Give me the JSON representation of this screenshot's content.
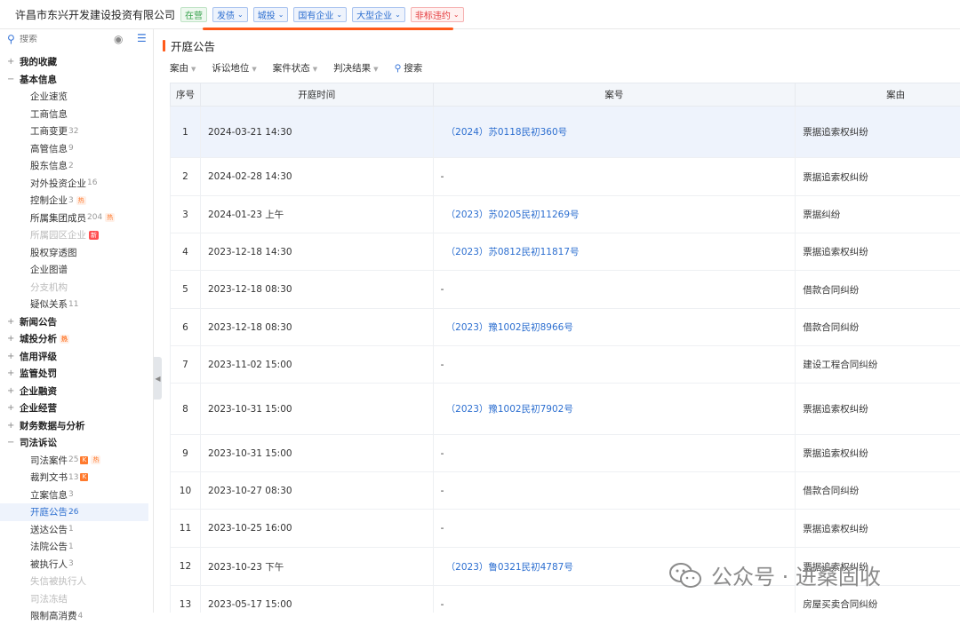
{
  "header": {
    "company": "许昌市东兴开发建设投资有限公司",
    "status_tag": "在营",
    "tags": [
      {
        "label": "发债",
        "color": "blue"
      },
      {
        "label": "城投",
        "color": "blue"
      },
      {
        "label": "国有企业",
        "color": "blue"
      },
      {
        "label": "大型企业",
        "color": "blue"
      },
      {
        "label": "非标违约",
        "color": "red"
      }
    ]
  },
  "sidebar": {
    "search_placeholder": "搜索",
    "tree": [
      {
        "type": "group",
        "label": "我的收藏",
        "sign": "+"
      },
      {
        "type": "group",
        "label": "基本信息",
        "sign": "−"
      },
      {
        "type": "child",
        "label": "企业速览"
      },
      {
        "type": "child",
        "label": "工商信息"
      },
      {
        "type": "child",
        "label": "工商变更",
        "count": "32"
      },
      {
        "type": "child",
        "label": "高管信息",
        "count": "9"
      },
      {
        "type": "child",
        "label": "股东信息",
        "count": "2"
      },
      {
        "type": "child",
        "label": "对外投资企业",
        "count": "16"
      },
      {
        "type": "child",
        "label": "控制企业",
        "count": "3",
        "badge": "hot",
        "badge_text": "热"
      },
      {
        "type": "child",
        "label": "所属集团成员",
        "count": "204",
        "badge": "hot",
        "badge_text": "热"
      },
      {
        "type": "child",
        "label": "所属园区企业",
        "disabled": true,
        "badge": "new",
        "badge_text": "新"
      },
      {
        "type": "child",
        "label": "股权穿透图"
      },
      {
        "type": "child",
        "label": "企业图谱"
      },
      {
        "type": "child",
        "label": "分支机构",
        "disabled": true
      },
      {
        "type": "child",
        "label": "疑似关系",
        "count": "11"
      },
      {
        "type": "group",
        "label": "新闻公告",
        "sign": "+"
      },
      {
        "type": "group",
        "label": "城投分析",
        "sign": "+",
        "badge": "hot",
        "badge_text": "热"
      },
      {
        "type": "group",
        "label": "信用评级",
        "sign": "+"
      },
      {
        "type": "group",
        "label": "监管处罚",
        "sign": "+"
      },
      {
        "type": "group",
        "label": "企业融资",
        "sign": "+"
      },
      {
        "type": "group",
        "label": "企业经营",
        "sign": "+"
      },
      {
        "type": "group",
        "label": "财务数据与分析",
        "sign": "+"
      },
      {
        "type": "group",
        "label": "司法诉讼",
        "sign": "−"
      },
      {
        "type": "child",
        "label": "司法案件",
        "count": "25",
        "badge": "k",
        "badge2": "hot",
        "badge_text": "热"
      },
      {
        "type": "child",
        "label": "裁判文书",
        "count": "13",
        "badge": "k"
      },
      {
        "type": "child",
        "label": "立案信息",
        "count": "3"
      },
      {
        "type": "child",
        "label": "开庭公告",
        "count": "26",
        "active": true
      },
      {
        "type": "child",
        "label": "送达公告",
        "count": "1"
      },
      {
        "type": "child",
        "label": "法院公告",
        "count": "1"
      },
      {
        "type": "child",
        "label": "被执行人",
        "count": "3"
      },
      {
        "type": "child",
        "label": "失信被执行人",
        "disabled": true
      },
      {
        "type": "child",
        "label": "司法冻结",
        "disabled": true
      },
      {
        "type": "child",
        "label": "限制高消费",
        "count": "4"
      }
    ]
  },
  "main": {
    "title": "开庭公告",
    "filters": [
      "案由",
      "诉讼地位",
      "案件状态",
      "判决结果"
    ],
    "search_label": "搜索",
    "columns": [
      "序号",
      "开庭时间",
      "案号",
      "案由"
    ],
    "rows": [
      {
        "no": "1",
        "time": "2024-03-21 14:30",
        "case": "（2024）苏0118民初360号",
        "reason": "票据追索权纠纷"
      },
      {
        "no": "2",
        "time": "2024-02-28 14:30",
        "case": "-",
        "reason": "票据追索权纠纷"
      },
      {
        "no": "3",
        "time": "2024-01-23 上午",
        "case": "（2023）苏0205民初11269号",
        "reason": "票据纠纷"
      },
      {
        "no": "4",
        "time": "2023-12-18 14:30",
        "case": "（2023）苏0812民初11817号",
        "reason": "票据追索权纠纷"
      },
      {
        "no": "5",
        "time": "2023-12-18 08:30",
        "case": "-",
        "reason": "借款合同纠纷"
      },
      {
        "no": "6",
        "time": "2023-12-18 08:30",
        "case": "（2023）豫1002民初8966号",
        "reason": "借款合同纠纷"
      },
      {
        "no": "7",
        "time": "2023-11-02 15:00",
        "case": "-",
        "reason": "建设工程合同纠纷"
      },
      {
        "no": "8",
        "time": "2023-10-31 15:00",
        "case": "（2023）豫1002民初7902号",
        "reason": "票据追索权纠纷"
      },
      {
        "no": "9",
        "time": "2023-10-31 15:00",
        "case": "-",
        "reason": "票据追索权纠纷"
      },
      {
        "no": "10",
        "time": "2023-10-27 08:30",
        "case": "-",
        "reason": "借款合同纠纷"
      },
      {
        "no": "11",
        "time": "2023-10-25 16:00",
        "case": "-",
        "reason": "票据追索权纠纷"
      },
      {
        "no": "12",
        "time": "2023-10-23 下午",
        "case": "（2023）鲁0321民初4787号",
        "reason": "票据追索权纠纷"
      },
      {
        "no": "13",
        "time": "2023-05-17 15:00",
        "case": "-",
        "reason": "房屋买卖合同纠纷"
      }
    ]
  },
  "watermark": {
    "text": "公众号 · 进桑固收"
  }
}
